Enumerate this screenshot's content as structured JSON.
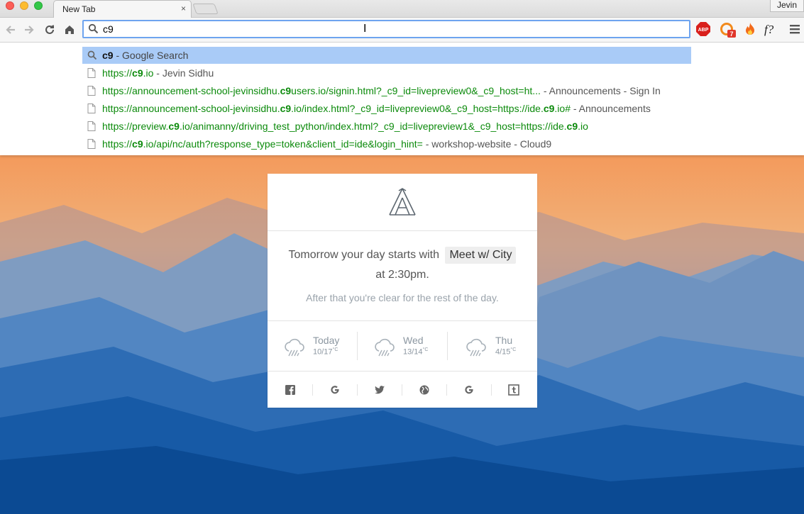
{
  "browser": {
    "tab_title": "New Tab",
    "tab_close": "×",
    "profile_name": "Jevin",
    "omnibox_value": "c9",
    "cursor_glyph": "I",
    "extensions": [
      "abp-icon",
      "notification-icon",
      "fire-icon",
      "font-finder-icon",
      "menu-icon"
    ],
    "extension_badge": "7"
  },
  "suggestions": [
    {
      "type": "search",
      "query": "c9",
      "desc": " - Google Search"
    },
    {
      "type": "page",
      "url_parts": [
        [
          "https://",
          false
        ],
        [
          "c9",
          true
        ],
        [
          ".io",
          false
        ]
      ],
      "desc": " - Jevin Sidhu"
    },
    {
      "type": "page",
      "url_parts": [
        [
          "https://announcement-school-jevinsidhu.",
          false
        ],
        [
          "c9",
          true
        ],
        [
          "users.io/signin.html?_c9_id=livepreview0&_c9_host=ht...",
          false
        ]
      ],
      "desc": "  - Announcements - Sign In"
    },
    {
      "type": "page",
      "url_parts": [
        [
          "https://announcement-school-jevinsidhu.",
          false
        ],
        [
          "c9",
          true
        ],
        [
          ".io/index.html?_c9_id=livepreview0&_c9_host=https://ide.",
          false
        ],
        [
          "c9",
          true
        ],
        [
          ".io#",
          false
        ]
      ],
      "desc": " - Announcements"
    },
    {
      "type": "page",
      "url_parts": [
        [
          "https://preview.",
          false
        ],
        [
          "c9",
          true
        ],
        [
          ".io/animanny/driving_test_python/index.html?_c9_id=livepreview1&_c9_host=https://ide.",
          false
        ],
        [
          "c9",
          true
        ],
        [
          ".io",
          false
        ]
      ],
      "desc": ""
    },
    {
      "type": "page",
      "url_parts": [
        [
          "https://",
          false
        ],
        [
          "c9",
          true
        ],
        [
          ".io/api/nc/auth?response_type=token&client_id=ide&login_hint=",
          false
        ]
      ],
      "desc": " - workshop-website - Cloud9"
    }
  ],
  "card": {
    "agenda_prefix": "Tomorrow your day starts with",
    "event_name": "Meet w/ City",
    "agenda_time": "at 2:30pm.",
    "agenda_sub": "After that you're clear for the rest of the day.",
    "weather": [
      {
        "day": "Today",
        "temps": "10/17",
        "unit": "°C",
        "icon": "rain-cloud-icon"
      },
      {
        "day": "Wed",
        "temps": "13/14",
        "unit": "°C",
        "icon": "rain-cloud-icon"
      },
      {
        "day": "Thu",
        "temps": "4/15",
        "unit": "°C",
        "icon": "rain-cloud-icon"
      }
    ],
    "shortcuts": [
      "facebook-icon",
      "google-icon",
      "twitter-icon",
      "globe-icon",
      "google-icon",
      "tumblr-icon"
    ]
  },
  "colors": {
    "url_green": "#0b8a0b",
    "selected_row": "#a9cbf7",
    "omnibox_focus": "#6ea4ef",
    "sky_top": "#f4a56a",
    "mountain_dark": "#0b4a93"
  }
}
